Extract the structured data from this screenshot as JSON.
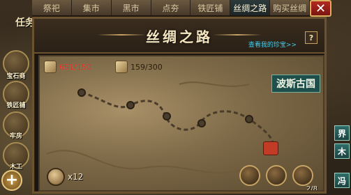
{
  "tabs": [
    "祭祀",
    "集市",
    "黑市",
    "点夯",
    "铁匠铺",
    "丝绸之路",
    "购买丝绸"
  ],
  "active_tab_index": 5,
  "side_menu": {
    "top_label": "任务",
    "items": [
      "宝石商",
      "铁匠铺",
      "牢房",
      "木工"
    ]
  },
  "panel": {
    "title": "丝绸之路",
    "treasure_link": "查看我的珍宝>>",
    "help": "?"
  },
  "resources": {
    "silk": "651/150",
    "stamina": "159/300"
  },
  "country": "波斯古国",
  "horn_count": "x12",
  "page_indicator": "2/8",
  "world_buttons": [
    "界",
    "木",
    "冯"
  ],
  "colors": {
    "accent_gold": "#c7a365",
    "link_cyan": "#3fd0f0",
    "warn_red": "#e02e20",
    "country_teal": "#1f4f4a"
  }
}
